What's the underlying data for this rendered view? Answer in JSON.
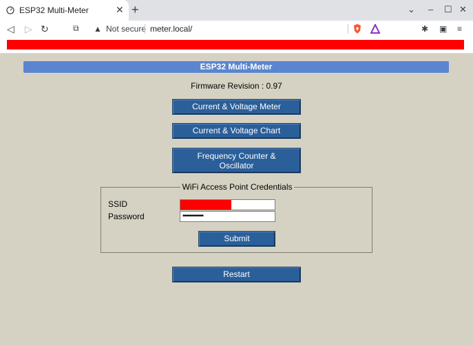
{
  "browser": {
    "tab_title": "ESP32 Multi-Meter",
    "tab_close": "✕",
    "new_tab": "+",
    "window_controls": {
      "dropdown": "⌄",
      "minimize": "–",
      "maximize": "☐",
      "close": "✕"
    },
    "nav": {
      "back": "◁",
      "forward": "▷",
      "reload": "↻",
      "bookmark": "⧉"
    },
    "security_icon": "▲",
    "security_label": "Not secure",
    "url": "meter.local/",
    "toolbar_icons": {
      "extensions": "✱",
      "wallet": "▣",
      "menu": "≡"
    }
  },
  "page": {
    "header": "ESP32 Multi-Meter",
    "firmware": "Firmware Revision : 0.97",
    "buttons": {
      "meter": "Current & Voltage Meter",
      "chart": "Current & Voltage Chart",
      "freq_line1": "Frequency Counter &",
      "freq_line2": "Oscillator",
      "submit": "Submit",
      "restart": "Restart"
    },
    "wifi": {
      "legend": "WiFi Access Point Credentials",
      "ssid_label": "SSID",
      "password_label": "Password",
      "password_value": "••••••••••••"
    }
  },
  "colors": {
    "page_background": "#d6d2c3",
    "header_bar": "#5b86cf",
    "button": "#2a5f9a",
    "redaction": "#ff0000"
  }
}
